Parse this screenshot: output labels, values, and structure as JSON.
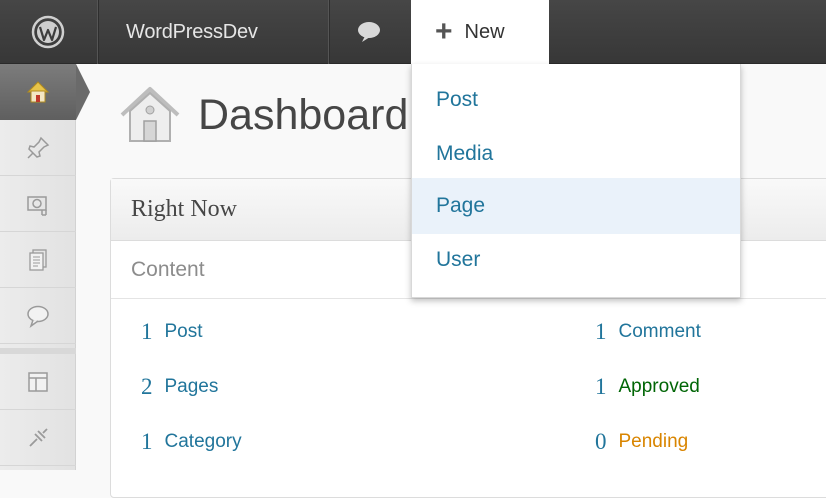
{
  "adminbar": {
    "site_name": "WordPressDev",
    "new_label": "New",
    "icons": [
      "wordpress-logo-icon",
      "comment-bubble-icon",
      "plus-icon"
    ]
  },
  "new_menu": {
    "items": [
      {
        "label": "Post"
      },
      {
        "label": "Media"
      },
      {
        "label": "Page",
        "highlighted": true
      },
      {
        "label": "User"
      }
    ]
  },
  "sidebar": {
    "items": [
      "dashboard-icon",
      "pin-icon",
      "media-icon",
      "pages-icon",
      "comments-icon",
      "appearance-icon",
      "plugins-icon"
    ],
    "active": "dashboard-icon"
  },
  "page": {
    "title": "Dashboard"
  },
  "right_now": {
    "title": "Right Now",
    "section": "Content",
    "content_stats": [
      {
        "num": "1",
        "label": "Post"
      },
      {
        "num": "2",
        "label": "Pages"
      },
      {
        "num": "1",
        "label": "Category"
      }
    ],
    "discussion_stats": [
      {
        "num": "1",
        "label": "Comment"
      },
      {
        "num": "1",
        "label": "Approved"
      },
      {
        "num": "0",
        "label": "Pending"
      }
    ]
  },
  "colors": {
    "link": "#21759b",
    "approved": "#006505",
    "pending": "#d98500",
    "adminbar": "#3d3d3d"
  }
}
